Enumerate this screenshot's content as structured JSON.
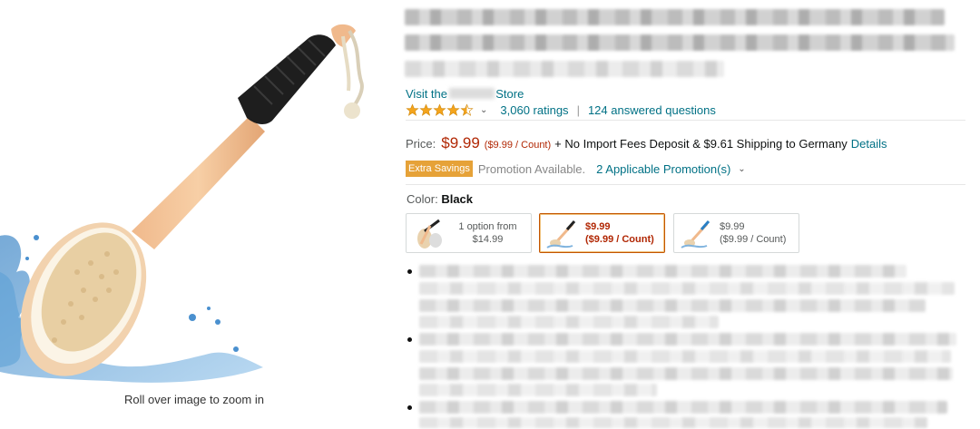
{
  "image": {
    "zoom_hint": "Roll over image to zoom in"
  },
  "store": {
    "prefix": "Visit the",
    "suffix": "Store"
  },
  "ratings": {
    "stars": 4.5,
    "count_label": "3,060 ratings",
    "answered_label": "124 answered questions"
  },
  "price": {
    "label": "Price:",
    "value": "$9.99",
    "unit": "($9.99 / Count)",
    "shipping": "+ No Import Fees Deposit & $9.61 Shipping to Germany",
    "details_link": "Details"
  },
  "promotion": {
    "badge": "Extra Savings",
    "available": "Promotion Available.",
    "applicable": "2 Applicable Promotion(s)"
  },
  "color": {
    "label": "Color:",
    "value": "Black",
    "options": [
      {
        "line1": "1 option from",
        "line2": "$14.99"
      },
      {
        "line1": "$9.99",
        "line2": "($9.99 / Count)"
      },
      {
        "line1": "$9.99",
        "line2": "($9.99 / Count)"
      }
    ]
  },
  "colors": {
    "link": "#007185",
    "price": "#b12704",
    "star": "#f4a41c",
    "badge": "#e6a238"
  }
}
